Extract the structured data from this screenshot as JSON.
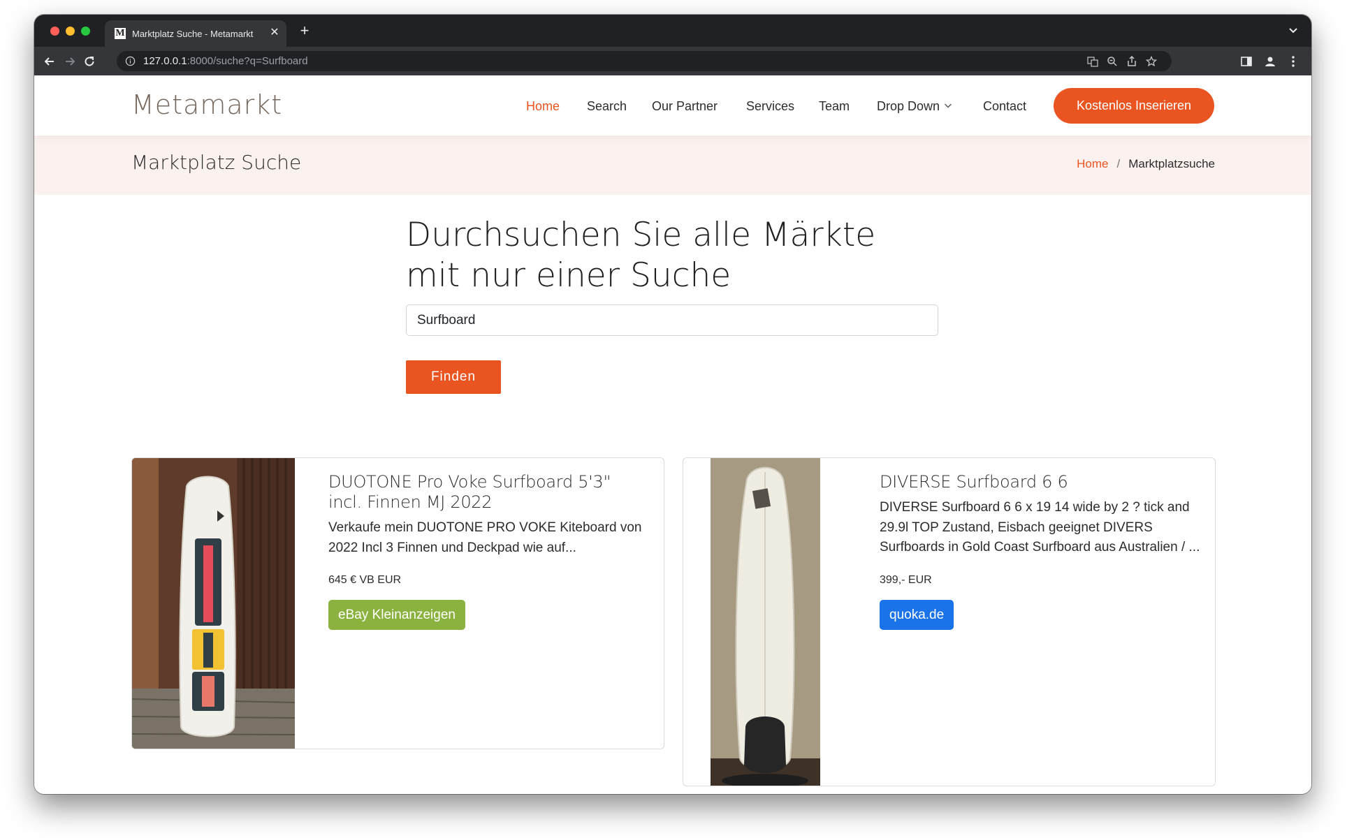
{
  "browser": {
    "tab_title": "Marktplatz Suche - Metamarkt",
    "favicon_letter": "M",
    "url_host": "127.0.0.1",
    "url_rest": ":8000/suche?q=Surfboard"
  },
  "site": {
    "logo": "Metamarkt",
    "nav": [
      {
        "label": "Home",
        "active": true
      },
      {
        "label": "Search"
      },
      {
        "label": "Our Partner"
      },
      {
        "label": "Services"
      },
      {
        "label": "Team"
      },
      {
        "label": "Drop Down",
        "has_dropdown": true
      },
      {
        "label": "Contact"
      }
    ],
    "cta_label": "Kostenlos Inserieren",
    "accent_color": "#e95420"
  },
  "page": {
    "title": "Marktplatz Suche",
    "breadcrumb": {
      "home": "Home",
      "separator": "/",
      "current": "Marktplatzsuche"
    }
  },
  "search": {
    "headline": "Durchsuchen Sie alle Märkte mit nur einer Suche",
    "query": "Surfboard",
    "button_label": "Finden"
  },
  "results": [
    {
      "title": "DUOTONE Pro Voke Surfboard 5'3\" incl. Finnen MJ 2022",
      "description": "Verkaufe mein DUOTONE PRO VOKE Kiteboard von 2022 Incl 3 Finnen und Deckpad wie auf...",
      "price": "645 € VB EUR",
      "source": "eBay Kleinanzeigen",
      "source_color": "#8bb23f"
    },
    {
      "title": "DIVERSE Surfboard 6 6",
      "description": "DIVERSE Surfboard 6 6 x 19 14 wide by 2 ? tick and 29.9l TOP Zustand, Eisbach geeignet DIVERS Surfboards in Gold Coast Surfboard aus Australien / ...",
      "price": "399,- EUR",
      "source": "quoka.de",
      "source_color": "#1a73e8"
    }
  ]
}
